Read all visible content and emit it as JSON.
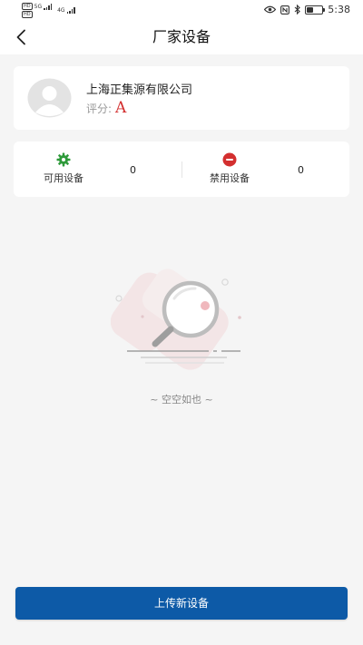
{
  "status_bar": {
    "sim1": {
      "badge": "HD",
      "network": "5G"
    },
    "sim2": {
      "badge": "HD",
      "network": "4G"
    },
    "time": "5:38",
    "icons": [
      "eye-icon",
      "nfc-icon",
      "bluetooth-icon",
      "battery-icon"
    ]
  },
  "nav": {
    "title": "厂家设备",
    "back_icon": "chevron-left-icon"
  },
  "company": {
    "name": "上海正集源有限公司",
    "rating_label": "评分:",
    "rating_value": "A",
    "rating_color": "#d32f2f"
  },
  "stats": {
    "available": {
      "label": "可用设备",
      "count": "0",
      "icon": "gear-icon",
      "color": "#2e9a3a"
    },
    "disabled": {
      "label": "禁用设备",
      "count": "0",
      "icon": "minus-circle-icon",
      "color": "#d32f2f"
    }
  },
  "empty_state": {
    "text": "~ 空空如也 ~",
    "icon": "magnifier-empty-icon"
  },
  "actions": {
    "upload_label": "上传新设备",
    "upload_color": "#0d5aa7"
  }
}
